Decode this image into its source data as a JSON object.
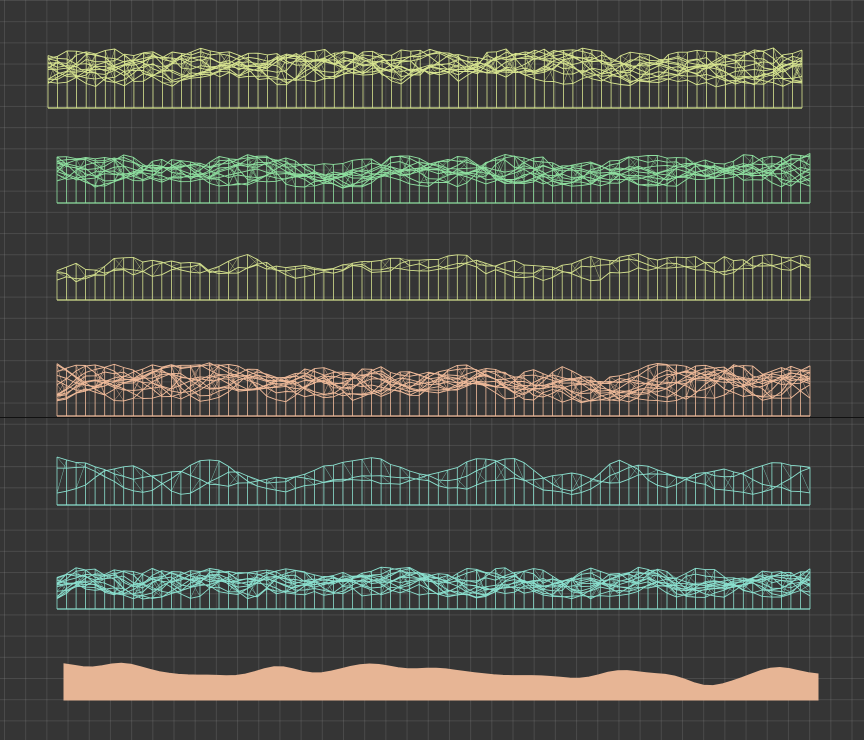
{
  "viewport": {
    "background": "#353535",
    "grid_color": "#5a5a5a",
    "horizon_color": "#111111"
  },
  "meshes": [
    {
      "id": "mesh-1",
      "style": "wireframe",
      "color": "#d8e590",
      "rows": 12,
      "columns": 80,
      "amplitude": 0.55,
      "roughness": 0.7
    },
    {
      "id": "mesh-2",
      "style": "wireframe",
      "color": "#8fe0a0",
      "rows": 11,
      "columns": 80,
      "amplitude": 0.62,
      "roughness": 1.0
    },
    {
      "id": "mesh-3",
      "style": "wireframe",
      "color": "#d4e08e",
      "rows": 3,
      "columns": 80,
      "amplitude": 0.5,
      "roughness": 1.0
    },
    {
      "id": "mesh-4",
      "style": "wireframe",
      "color": "#f0bb9a",
      "rows": 12,
      "columns": 80,
      "amplitude": 0.7,
      "roughness": 1.1
    },
    {
      "id": "mesh-5",
      "style": "wireframe",
      "color": "#8be0cf",
      "rows": 3,
      "columns": 80,
      "amplitude": 0.75,
      "roughness": 0.4
    },
    {
      "id": "mesh-6",
      "style": "wireframe",
      "color": "#8be0cf",
      "rows": 12,
      "columns": 80,
      "amplitude": 0.7,
      "roughness": 1.4
    },
    {
      "id": "mesh-7",
      "style": "solid",
      "color": "#e7b595",
      "rows": 1,
      "columns": 80,
      "amplitude": 0.55,
      "roughness": 0.5
    }
  ]
}
